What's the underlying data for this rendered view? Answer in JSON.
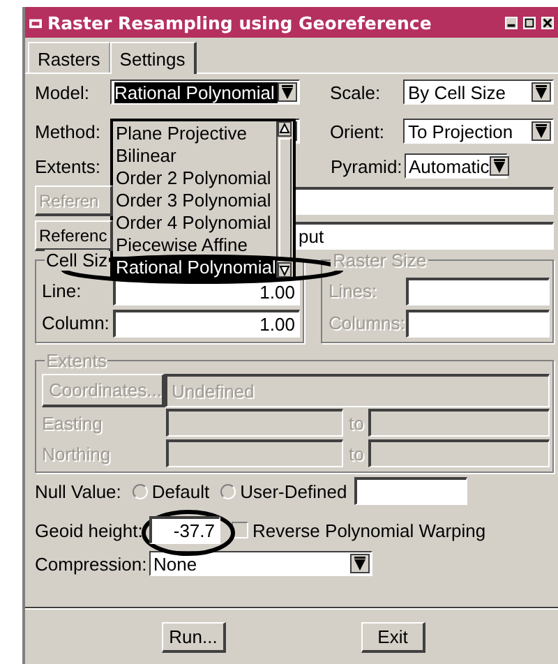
{
  "window": {
    "title": "Raster Resampling using Georeference"
  },
  "tabs": [
    {
      "label": "Rasters",
      "selected": false
    },
    {
      "label": "Settings",
      "selected": true
    }
  ],
  "model": {
    "label": "Model:",
    "value": "Rational Polynomial",
    "expanded": true
  },
  "model_list": [
    {
      "label": "Plane Projective",
      "selected": false
    },
    {
      "label": "Bilinear",
      "selected": false
    },
    {
      "label": "Order 2 Polynomial",
      "selected": false
    },
    {
      "label": "Order 3 Polynomial",
      "selected": false
    },
    {
      "label": "Order 4 Polynomial",
      "selected": false
    },
    {
      "label": "Piecewise Affine",
      "selected": false
    },
    {
      "label": "Rational Polynomial",
      "selected": true
    }
  ],
  "method": {
    "label": "Method:"
  },
  "extents_row": {
    "label": "Extents:"
  },
  "scale": {
    "label": "Scale:",
    "value": "By Cell Size"
  },
  "orient": {
    "label": "Orient:",
    "value": "To Projection"
  },
  "pyramid": {
    "label": "Pyramid:",
    "value": "Automatic"
  },
  "reference_rows": [
    {
      "button": "Referen",
      "disabled": true
    },
    {
      "button": "Referenc",
      "disabled": false,
      "value": "put"
    }
  ],
  "cell_size": {
    "title": "Cell Siz",
    "rows": [
      {
        "label": "Line:",
        "value": "1.00"
      },
      {
        "label": "Column:",
        "value": "1.00"
      }
    ]
  },
  "raster_size": {
    "title": "Raster Size",
    "disabled": true,
    "rows": [
      {
        "label": "Lines:"
      },
      {
        "label": "Columns:"
      }
    ]
  },
  "extents": {
    "title": "Extents",
    "disabled": true,
    "button": "Coordinates...",
    "value": "Undefined",
    "rows": [
      {
        "label": "Easting",
        "to": "to"
      },
      {
        "label": "Northing",
        "to": "to"
      }
    ]
  },
  "null_value": {
    "label": "Null Value:",
    "options": [
      {
        "label": "Default",
        "selected": false
      },
      {
        "label": "User-Defined",
        "selected": false
      }
    ]
  },
  "geoid": {
    "label": "Geoid height:",
    "value": "-37.7"
  },
  "reverse": {
    "label": "Reverse Polynomial Warping",
    "checked": false
  },
  "compression": {
    "label": "Compression:",
    "value": "None"
  },
  "buttons": [
    {
      "label": "Run..."
    },
    {
      "label": "Exit"
    }
  ]
}
